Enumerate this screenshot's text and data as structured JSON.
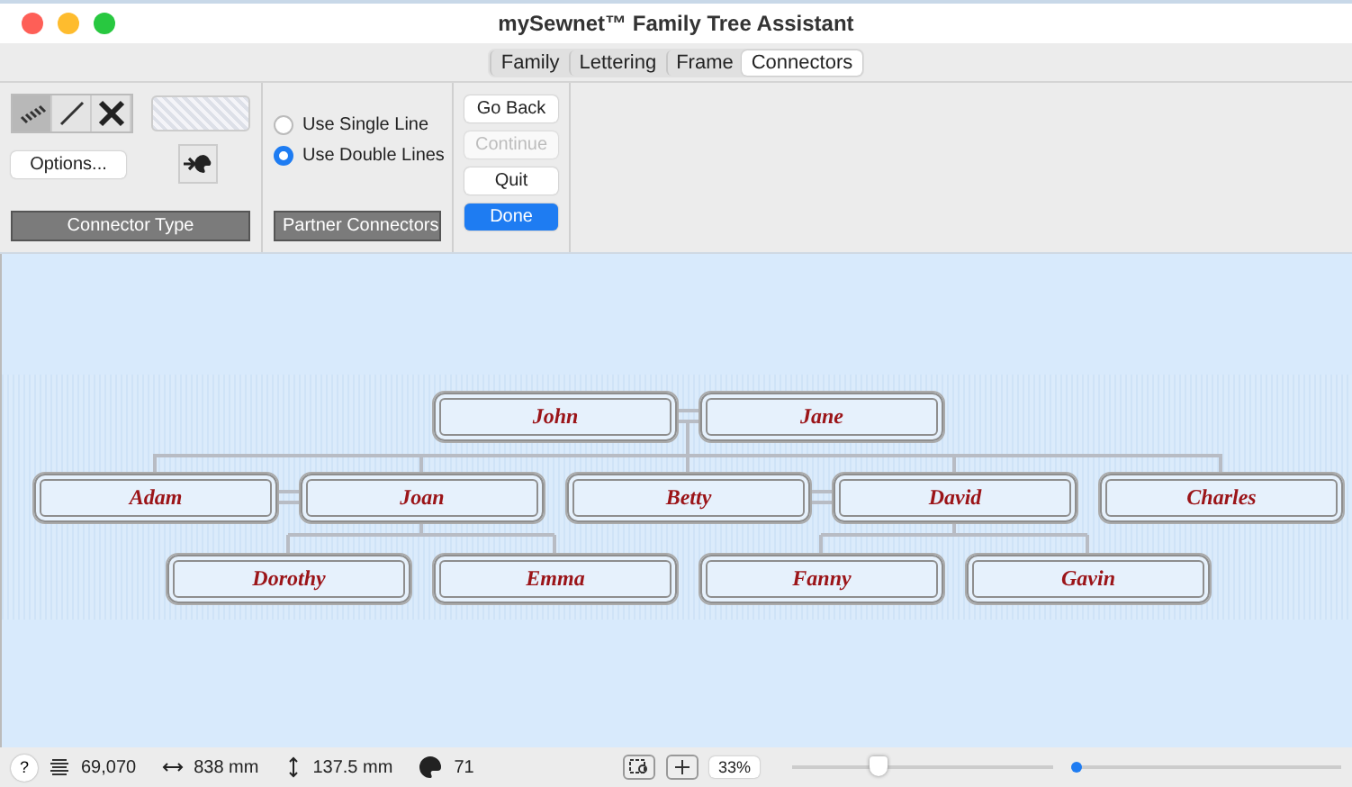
{
  "window": {
    "title": "mySewnet™ Family Tree Assistant"
  },
  "tabs": [
    {
      "label": "Family",
      "selected": false
    },
    {
      "label": "Lettering",
      "selected": false
    },
    {
      "label": "Frame",
      "selected": false
    },
    {
      "label": "Connectors",
      "selected": true
    }
  ],
  "connector_type": {
    "styles": [
      {
        "kind": "stitched",
        "selected": true
      },
      {
        "kind": "line",
        "selected": false
      },
      {
        "kind": "none",
        "selected": false
      }
    ],
    "options_button": "Options...",
    "label": "Connector Type"
  },
  "partner_connectors": {
    "options": [
      {
        "label": "Use Single Line",
        "selected": false
      },
      {
        "label": "Use Double Lines",
        "selected": true
      }
    ],
    "label": "Partner Connectors"
  },
  "buttons": [
    {
      "label": "Go Back",
      "disabled": false,
      "primary": false
    },
    {
      "label": "Continue",
      "disabled": true,
      "primary": false
    },
    {
      "label": "Quit",
      "disabled": false,
      "primary": false
    },
    {
      "label": "Done",
      "disabled": false,
      "primary": true
    }
  ],
  "tree": {
    "generations": [
      {
        "names": [
          "John",
          "Jane"
        ]
      },
      {
        "names": [
          "Adam",
          "Joan",
          "Betty",
          "David",
          "Charles"
        ]
      },
      {
        "names": [
          "Dorothy",
          "Emma",
          "Fanny",
          "Gavin"
        ]
      }
    ]
  },
  "status_bar": {
    "help": "?",
    "stitches": "69,070",
    "width": "838 mm",
    "height": "137.5 mm",
    "colors": "71",
    "zoom": "33%",
    "zoom_slider": {
      "level": 0.33
    },
    "position_slider": {
      "level": 0.02
    }
  }
}
